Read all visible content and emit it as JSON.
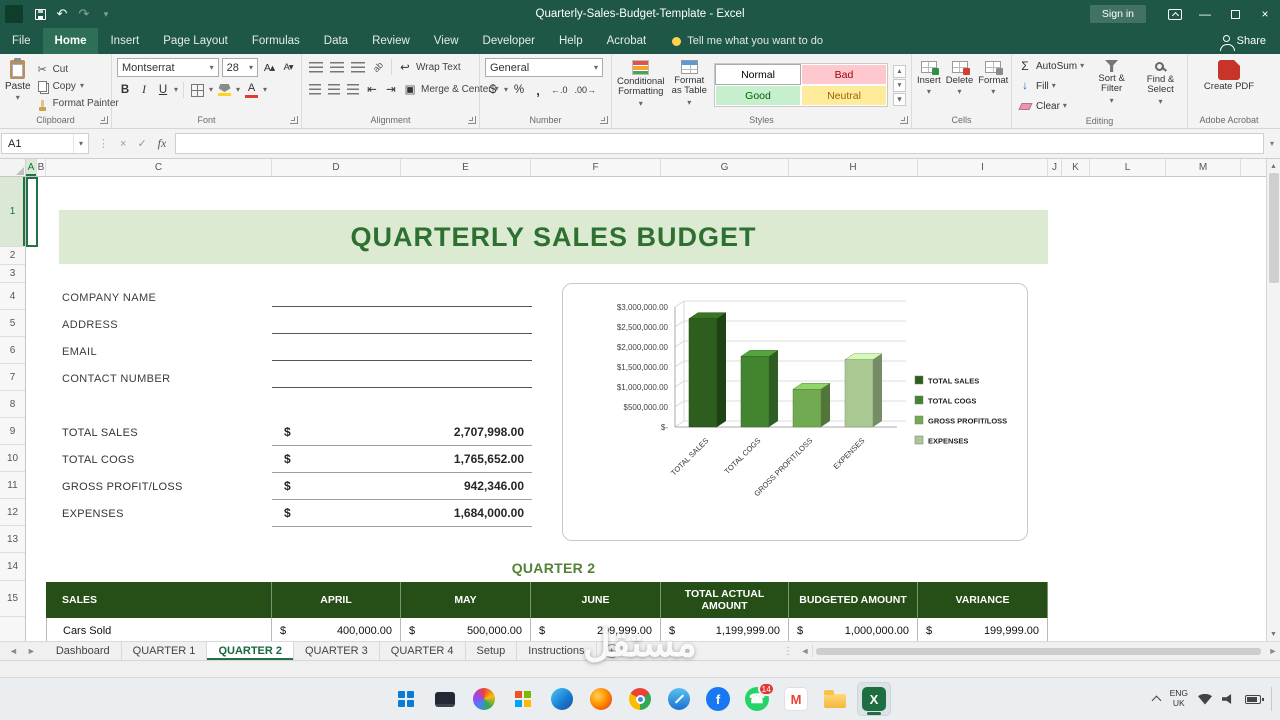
{
  "colors": {
    "titlebar": "#1e5748",
    "titlebar_active_tab": "#2e6f58",
    "excel_green": "#217346",
    "ribbon_bg": "#f3f3f3",
    "band_bg": "#dcead2",
    "band_text": "#2e7031",
    "quarter_text": "#538135",
    "table_head_bg": "#254f17",
    "style_bad_bg": "#ffc7ce",
    "style_bad_text": "#9c0006",
    "style_good_bg": "#c6efce",
    "style_good_text": "#006100",
    "style_neutral_bg": "#ffeb9c",
    "style_neutral_text": "#9c6500",
    "taskbar_bg": "#ebeef1"
  },
  "title_bar": {
    "title": "Quarterly-Sales-Budget-Template - Excel",
    "sign_in": "Sign in"
  },
  "ribbon": {
    "tabs": [
      {
        "label": "File",
        "active": false
      },
      {
        "label": "Home",
        "active": true
      },
      {
        "label": "Insert",
        "active": false
      },
      {
        "label": "Page Layout",
        "active": false
      },
      {
        "label": "Formulas",
        "active": false
      },
      {
        "label": "Data",
        "active": false
      },
      {
        "label": "Review",
        "active": false
      },
      {
        "label": "View",
        "active": false
      },
      {
        "label": "Developer",
        "active": false
      },
      {
        "label": "Help",
        "active": false
      },
      {
        "label": "Acrobat",
        "active": false
      }
    ],
    "tell_me": "Tell me what you want to do",
    "share": "Share",
    "clipboard": {
      "label": "Clipboard",
      "paste": "Paste",
      "cut": "Cut",
      "copy": "Copy",
      "format_painter": "Format Painter"
    },
    "font": {
      "label": "Font",
      "name": "Montserrat",
      "size": "28"
    },
    "alignment": {
      "label": "Alignment",
      "wrap_text": "Wrap Text",
      "merge_center": "Merge & Center"
    },
    "number": {
      "label": "Number",
      "format": "General"
    },
    "styles": {
      "label": "Styles",
      "conditional_formatting": "Conditional Formatting",
      "format_as_table": "Format as Table",
      "cell_styles": [
        "Normal",
        "Bad",
        "Good",
        "Neutral"
      ]
    },
    "cells": {
      "label": "Cells",
      "insert": "Insert",
      "delete": "Delete",
      "format": "Format"
    },
    "editing": {
      "label": "Editing",
      "autosum": "AutoSum",
      "fill": "Fill",
      "clear": "Clear",
      "sort_filter": "Sort & Filter",
      "find_select": "Find & Select"
    },
    "acrobat": {
      "label": "Adobe Acrobat",
      "create_pdf": "Create PDF"
    }
  },
  "formula_bar": {
    "name_box": "A1",
    "fx": "fx"
  },
  "grid": {
    "columns": [
      "A",
      "B",
      "C",
      "D",
      "E",
      "F",
      "G",
      "H",
      "I",
      "J",
      "K",
      "L",
      "M"
    ],
    "rows": [
      "1",
      "2",
      "3",
      "4",
      "5",
      "6",
      "7",
      "8",
      "9",
      "10",
      "11",
      "12",
      "13",
      "14",
      "15"
    ]
  },
  "sheet": {
    "title": "QUARTERLY SALES BUDGET",
    "form_fields": [
      "COMPANY NAME",
      "ADDRESS",
      "EMAIL",
      "CONTACT NUMBER"
    ],
    "summary": [
      {
        "label": "TOTAL SALES",
        "currency": "$",
        "value": "2,707,998.00"
      },
      {
        "label": "TOTAL COGS",
        "currency": "$",
        "value": "1,765,652.00"
      },
      {
        "label": "GROSS PROFIT/LOSS",
        "currency": "$",
        "value": "942,346.00"
      },
      {
        "label": "EXPENSES",
        "currency": "$",
        "value": "1,684,000.00"
      }
    ],
    "quarter_label": "QUARTER 2",
    "table": {
      "headers": [
        "SALES",
        "APRIL",
        "MAY",
        "JUNE",
        "TOTAL ACTUAL AMOUNT",
        "BUDGETED AMOUNT",
        "VARIANCE"
      ],
      "rows": [
        {
          "label": "Cars Sold",
          "cells": [
            {
              "currency": "$",
              "value": "400,000.00"
            },
            {
              "currency": "$",
              "value": "500,000.00"
            },
            {
              "currency": "$",
              "value": "299,999.00"
            },
            {
              "currency": "$",
              "value": "1,199,999.00"
            },
            {
              "currency": "$",
              "value": "1,000,000.00"
            },
            {
              "currency": "$",
              "value": "199,999.00"
            }
          ]
        }
      ]
    }
  },
  "chart_data": {
    "type": "bar",
    "style": "3d-column",
    "categories": [
      "TOTAL SALES",
      "TOTAL COGS",
      "GROSS PROFIT/LOSS",
      "EXPENSES"
    ],
    "values": [
      2707998,
      1765652,
      942346,
      1684000
    ],
    "ylim": [
      0,
      3000000
    ],
    "ytick_interval": 500000,
    "yticks": [
      "$3,000,000.00",
      "$2,500,000.00",
      "$2,000,000.00",
      "$1,500,000.00",
      "$1,000,000.00",
      "$500,000.00",
      "$-"
    ],
    "legend": [
      "TOTAL SALES",
      "TOTAL COGS",
      "GROSS PROFIT/LOSS",
      "EXPENSES"
    ],
    "legend_position": "right",
    "bar_colors": [
      "#2d5e1e",
      "#438431",
      "#72aa52",
      "#a9c892"
    ],
    "grid": true,
    "title": "",
    "xlabel": "",
    "ylabel": ""
  },
  "sheet_tabs": {
    "items": [
      {
        "label": "Dashboard",
        "active": false
      },
      {
        "label": "QUARTER 1",
        "active": false
      },
      {
        "label": "QUARTER 2",
        "active": true
      },
      {
        "label": "QUARTER 3",
        "active": false
      },
      {
        "label": "QUARTER 4",
        "active": false
      },
      {
        "label": "Setup",
        "active": false
      },
      {
        "label": "Instructions",
        "active": false
      }
    ],
    "add_label": "+"
  },
  "taskbar": {
    "icons": [
      {
        "name": "start-button",
        "kind": "windows"
      },
      {
        "name": "desktop-app",
        "kind": "monitor"
      },
      {
        "name": "photos-app",
        "kind": "pinwheel"
      },
      {
        "name": "office-app",
        "kind": "grid4"
      },
      {
        "name": "edge-browser",
        "kind": "edge"
      },
      {
        "name": "firefox-browser",
        "kind": "firefox"
      },
      {
        "name": "chrome-browser",
        "kind": "chrome"
      },
      {
        "name": "safari-browser",
        "kind": "safari"
      },
      {
        "name": "facebook-app",
        "kind": "glyph",
        "glyph": "f",
        "bg": "#1877f2",
        "fg": "#ffffff"
      },
      {
        "name": "whatsapp-app",
        "kind": "glyph",
        "glyph": "☎",
        "bg": "#25d366",
        "fg": "#ffffff",
        "badge": "14"
      },
      {
        "name": "gmail-app",
        "kind": "glyph",
        "shape": "square",
        "glyph": "M",
        "bg": "#ffffff",
        "fg": "#ea4335"
      },
      {
        "name": "folder-explorer",
        "kind": "folder"
      },
      {
        "name": "excel-app",
        "kind": "excel",
        "glyph": "X",
        "active": true
      }
    ],
    "language": {
      "line1": "ENG",
      "line2": "UK"
    }
  },
  "watermark": {
    "text": "مستقل"
  }
}
